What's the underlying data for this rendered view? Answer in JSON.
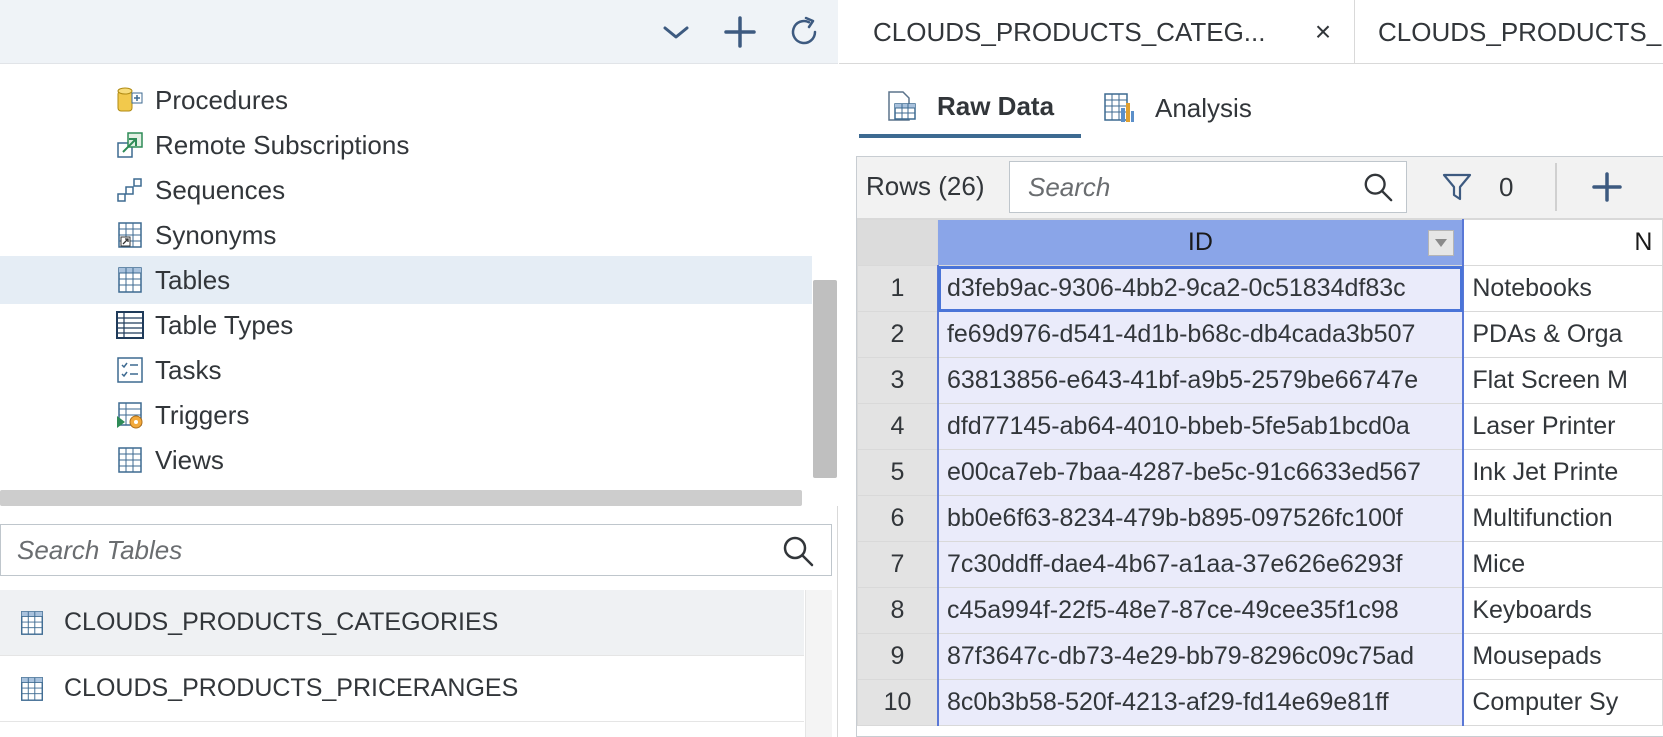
{
  "left": {
    "toolbar": {
      "collapse_icon": "chevron-down-icon",
      "add_icon": "plus-icon",
      "refresh_icon": "refresh-icon"
    },
    "tree": [
      {
        "label": "Procedures",
        "icon": "procedures-icon"
      },
      {
        "label": "Remote Subscriptions",
        "icon": "remote-subscriptions-icon"
      },
      {
        "label": "Sequences",
        "icon": "sequences-icon"
      },
      {
        "label": "Synonyms",
        "icon": "synonyms-icon"
      },
      {
        "label": "Tables",
        "icon": "tables-icon",
        "selected": true
      },
      {
        "label": "Table Types",
        "icon": "table-types-icon"
      },
      {
        "label": "Tasks",
        "icon": "tasks-icon"
      },
      {
        "label": "Triggers",
        "icon": "triggers-icon"
      },
      {
        "label": "Views",
        "icon": "views-icon"
      }
    ],
    "search_tables": {
      "placeholder": "Search Tables",
      "value": ""
    },
    "tables": [
      {
        "name": "CLOUDS_PRODUCTS_CATEGORIES",
        "active": true
      },
      {
        "name": "CLOUDS_PRODUCTS_PRICERANGES",
        "active": false
      }
    ]
  },
  "right": {
    "tabs": [
      {
        "label": "CLOUDS_PRODUCTS_CATEG...",
        "active": true,
        "close": "×"
      },
      {
        "label": "CLOUDS_PRODUCTS_",
        "active": false
      }
    ],
    "view_tabs": [
      {
        "label": "Raw Data",
        "icon": "raw-data-icon",
        "active": true
      },
      {
        "label": "Analysis",
        "icon": "analysis-icon",
        "active": false
      }
    ],
    "grid": {
      "rows_label": "Rows (26)",
      "search_placeholder": "Search",
      "search_value": "",
      "filter_count": "0",
      "columns": [
        "ID",
        "N"
      ],
      "rows": [
        {
          "n": "1",
          "id": "d3feb9ac-9306-4bb2-9ca2-0c51834df83c",
          "name": "Notebooks"
        },
        {
          "n": "2",
          "id": "fe69d976-d541-4d1b-b68c-db4cada3b507",
          "name": "PDAs & Orga"
        },
        {
          "n": "3",
          "id": "63813856-e643-41bf-a9b5-2579be66747e",
          "name": "Flat Screen M"
        },
        {
          "n": "4",
          "id": "dfd77145-ab64-4010-bbeb-5fe5ab1bcd0a",
          "name": "Laser Printer"
        },
        {
          "n": "5",
          "id": "e00ca7eb-7baa-4287-be5c-91c6633ed567",
          "name": "Ink Jet Printe"
        },
        {
          "n": "6",
          "id": "bb0e6f63-8234-479b-b895-097526fc100f",
          "name": "Multifunction"
        },
        {
          "n": "7",
          "id": "7c30ddff-dae4-4b67-a1aa-37e626e6293f",
          "name": "Mice"
        },
        {
          "n": "8",
          "id": "c45a994f-22f5-48e7-87ce-49cee35f1c98",
          "name": "Keyboards"
        },
        {
          "n": "9",
          "id": "87f3647c-db73-4e29-bb79-8296c09c75ad",
          "name": "Mousepads"
        },
        {
          "n": "10",
          "id": "8c0b3b58-520f-4213-af29-fd14e69e81ff",
          "name": "Computer Sy"
        }
      ]
    }
  },
  "colors": {
    "toolbar_bg": "#eff3f7",
    "selected_tree_bg": "#e5edf5",
    "id_header_bg": "#8aa5e8",
    "id_column_bg": "#eaebfa",
    "accent": "#3d6a91",
    "selection_outline": "#4a74d8"
  }
}
